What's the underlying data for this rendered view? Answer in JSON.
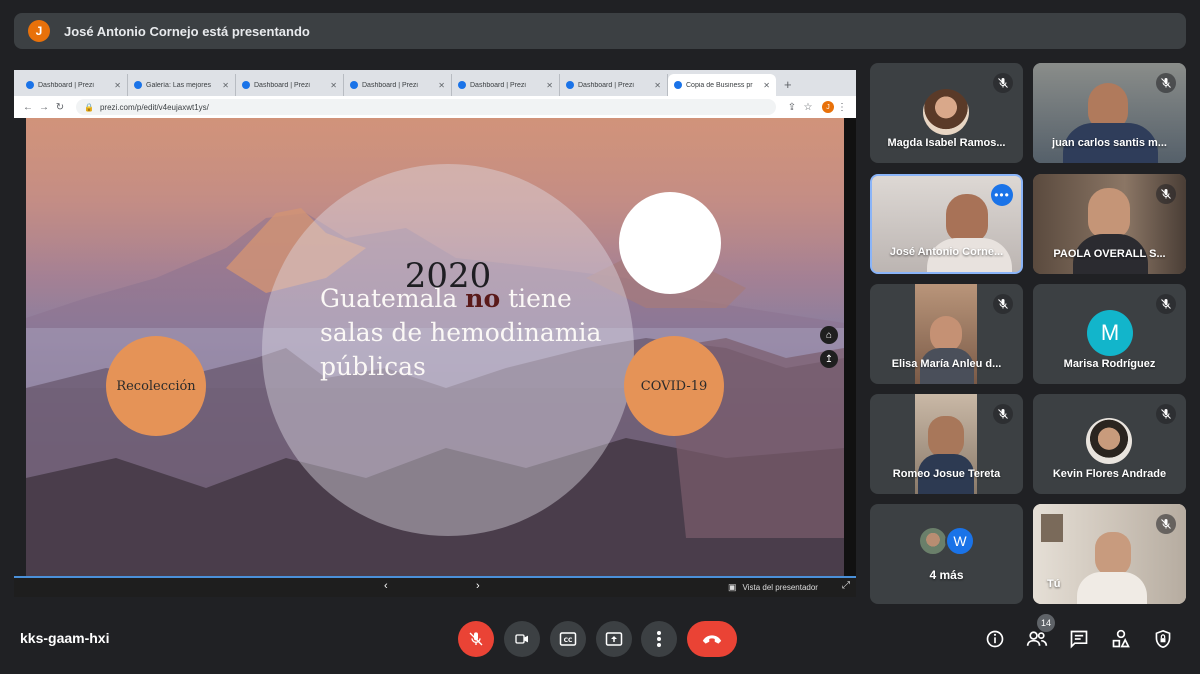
{
  "banner": {
    "avatar_letter": "J",
    "text": "José Antonio Cornejo está presentando"
  },
  "browser": {
    "tabs": [
      {
        "label": "Dashboard | Prezi"
      },
      {
        "label": "Galería: Las mejores"
      },
      {
        "label": "Dashboard | Prezi"
      },
      {
        "label": "Dashboard | Prezi"
      },
      {
        "label": "Dashboard | Prezi"
      },
      {
        "label": "Dashboard | Prezi"
      },
      {
        "label": "Copia de Business pr"
      }
    ],
    "url": "prezi.com/p/edit/v4eujaxwt1ys/",
    "profile_letter": "J"
  },
  "slide": {
    "year": "2020",
    "text_before": "Guatemala ",
    "text_highlight": "no",
    "text_after": " tiene salas de hemodinamia públicas",
    "left_circle": "Recolección",
    "right_circle": "COVID-19"
  },
  "presenter_controls": {
    "presenter_view": "Vista del presentador"
  },
  "participants": [
    {
      "name": "Magda Isabel Ramos..."
    },
    {
      "name": "juan carlos santis m..."
    },
    {
      "name": "José Antonio Corne..."
    },
    {
      "name": "PAOLA OVERALL S..."
    },
    {
      "name": "Elisa María Anleu d..."
    },
    {
      "name": "Marisa Rodríguez",
      "avatar_letter": "M"
    },
    {
      "name": "Romeo Josue Tereta"
    },
    {
      "name": "Kevin Flores Andrade"
    },
    {
      "name": "4 más",
      "avatar_letter": "W"
    },
    {
      "name": "Tú"
    }
  ],
  "bottom": {
    "meeting_code": "kks-gaam-hxi",
    "participant_count": "14"
  },
  "colors": {
    "background": "#202124",
    "tile": "#3c4043",
    "accent_red": "#ea4335",
    "accent_blue": "#1a73e8"
  }
}
